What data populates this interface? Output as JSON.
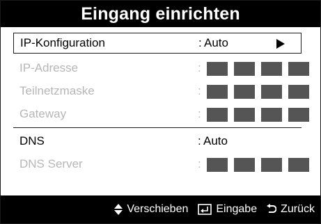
{
  "dialog": {
    "title": "Eingang einrichten"
  },
  "settings": {
    "ip_config": {
      "label": "IP-Konfiguration",
      "colon": ":",
      "value": "Auto"
    },
    "ip_address": {
      "label": "IP-Adresse",
      "colon": ":"
    },
    "subnet_mask": {
      "label": "Teilnetzmaske",
      "colon": ":"
    },
    "gateway": {
      "label": "Gateway",
      "colon": ":"
    },
    "dns": {
      "label": "DNS",
      "colon": ":",
      "value": "Auto"
    },
    "dns_server": {
      "label": "DNS Server",
      "colon": ":"
    }
  },
  "footer": {
    "move_label": "Verschieben",
    "enter_label": "Eingabe",
    "back_label": "Zurück",
    "move_icon": "up-down-arrows-icon",
    "enter_icon": "enter-icon",
    "back_icon": "return-icon"
  },
  "colors": {
    "bar_bg": "#000000",
    "panel_bg": "#ffffff",
    "disabled_text": "#b6b6b6",
    "octet_fill": "#555555"
  }
}
